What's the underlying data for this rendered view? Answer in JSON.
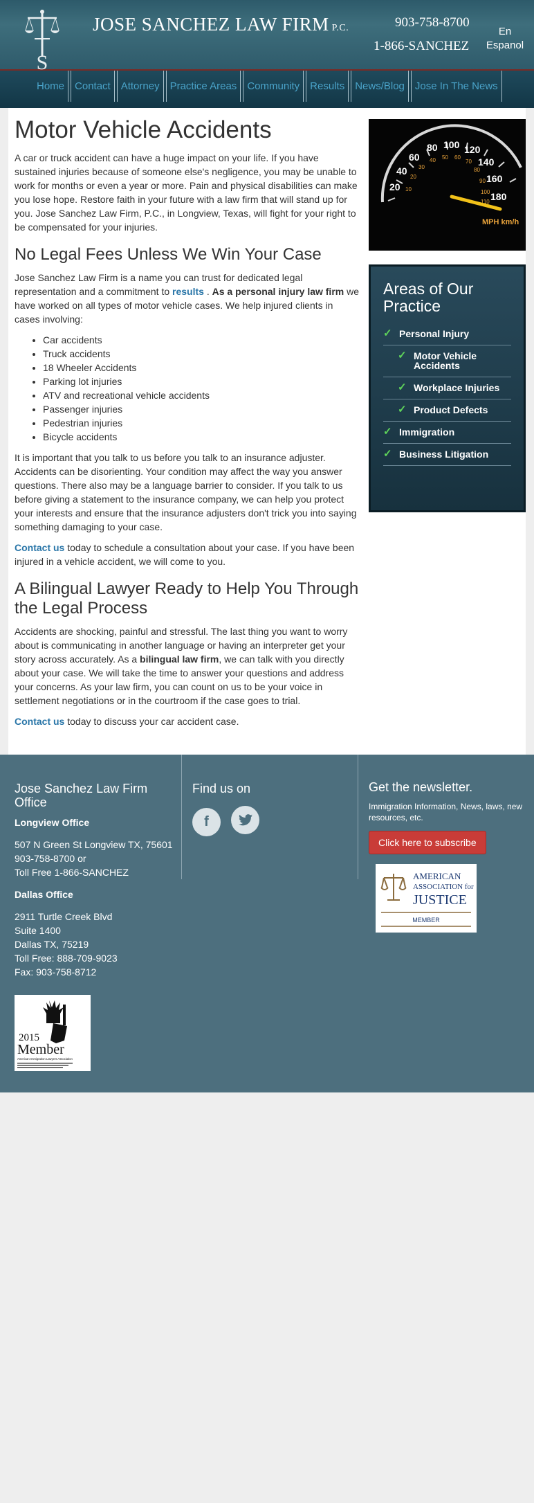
{
  "header": {
    "firm_name": "JOSE SANCHEZ LAW FIRM",
    "firm_suffix": "P.C.",
    "logo_letter": "S",
    "phone1": "903-758-8700",
    "phone2": "1-866-SANCHEZ",
    "lang_line1": "En",
    "lang_line2": "Espanol"
  },
  "nav": [
    "Home",
    "Contact",
    "Attorney",
    "Practice Areas",
    "Community",
    "Results",
    "News/Blog",
    "Jose In The News"
  ],
  "content": {
    "title": "Motor Vehicle Accidents",
    "intro": "A car or truck accident can have a huge impact on your life. If you have sustained injuries because of someone else's negligence, you may be unable to work for months or even a year or more. Pain and physical disabilities can make you lose hope. Restore faith in your future with a law firm that will stand up for you. Jose Sanchez Law Firm, P.C., in Longview, Texas, will fight for your right to be compensated for your injuries.",
    "h2_fees": "No Legal Fees Unless We Win Your Case",
    "fees_p1_a": "Jose Sanchez Law Firm is a name you can trust for dedicated legal representation and a commitment to ",
    "fees_p1_link": "results",
    "fees_p1_b": " . ",
    "fees_p1_bold": "As a personal injury law firm",
    "fees_p1_c": " we have worked on all types of motor vehicle cases. We help injured clients in cases involving:",
    "cases": [
      "Car accidents",
      "Truck accidents",
      "18 Wheeler Accidents",
      "Parking lot injuries",
      "ATV and recreational vehicle accidents",
      "Passenger injuries",
      "Pedestrian injuries",
      "Bicycle accidents"
    ],
    "important": "It is important that you talk to us before you talk to an insurance adjuster. Accidents can be disorienting. Your condition may affect the way you answer questions. There also may be a language barrier to consider. If you talk to us before giving a statement to the insurance company, we can help you protect your interests and ensure that the insurance adjusters don't trick you into saying something damaging to your case.",
    "contact1_link": "Contact us",
    "contact1_text": " today to schedule a consultation about your case. If you have been injured in a vehicle accident, we will come to you.",
    "h2_bilingual": "A Bilingual Lawyer Ready to Help You Through the Legal Process",
    "bilingual_a": "Accidents are shocking, painful and stressful. The last thing you want to worry about is communicating in another language or having an interpreter get your story across accurately. As a ",
    "bilingual_bold": "bilingual law firm",
    "bilingual_b": ", we can talk with you directly about your case. We will take the time to answer your questions and address your concerns. As your law firm, you can count on us to be your voice in settlement negotiations or in the courtroom if the case goes to trial.",
    "contact2_link": "Contact us",
    "contact2_text": " today to discuss your car accident case."
  },
  "sidebar": {
    "speedo_numbers": [
      "20",
      "40",
      "60",
      "80",
      "100",
      "120",
      "140",
      "160",
      "180"
    ],
    "speedo_units": "MPH km/h",
    "practice_title": "Areas of Our Practice",
    "practice_items": [
      {
        "label": "Personal Injury",
        "sub": false
      },
      {
        "label": "Motor Vehicle Accidents",
        "sub": true
      },
      {
        "label": "Workplace Injuries",
        "sub": true
      },
      {
        "label": "Product Defects",
        "sub": true
      },
      {
        "label": "Immigration",
        "sub": false
      },
      {
        "label": "Business Litigation",
        "sub": false
      }
    ]
  },
  "footer": {
    "col1_title": "Jose Sanchez Law Firm Office",
    "longview_label": "Longview Office",
    "longview_lines": [
      "507 N Green St Longview TX, 75601",
      "903-758-8700 or",
      "Toll Free 1-866-SANCHEZ"
    ],
    "dallas_label": "Dallas Office",
    "dallas_lines": [
      "2911 Turtle Creek Blvd",
      "Suite 1400",
      "Dallas TX, 75219",
      "Toll Free: 888-709-9023",
      "Fax: 903-758-8712"
    ],
    "find_title": "Find us on",
    "newsletter_title": "Get the newsletter.",
    "newsletter_text": "Immigration Information, News, laws, new resources, etc.",
    "subscribe_label": "Click here to subscribe",
    "aaj_line1": "AMERICAN",
    "aaj_line2": "ASSOCIATION for",
    "aaj_line3": "JUSTICE",
    "aaj_line4": "MEMBER",
    "badge_year": "2015",
    "badge_word": "Member",
    "badge_sub": "American Immigration Lawyers Association"
  },
  "colors": {
    "accent_link": "#2a76a8",
    "footer_bg": "#4d6f7e",
    "subscribe_btn": "#c93c38",
    "check": "#5fd45a"
  }
}
